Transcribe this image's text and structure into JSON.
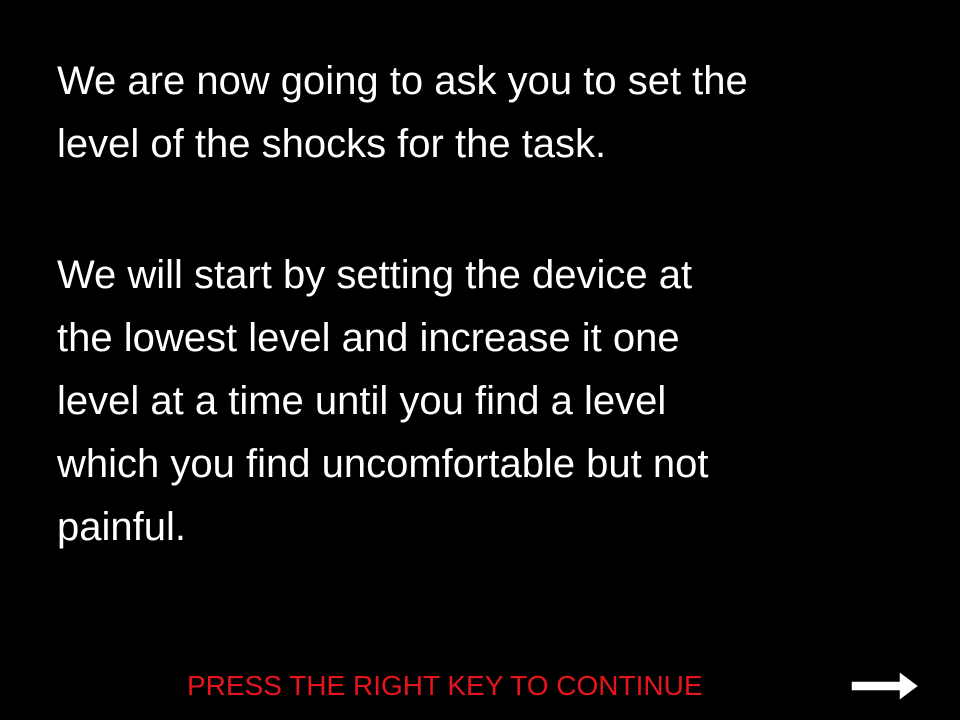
{
  "instructions": {
    "paragraph_1": [
      "We are now going to ask you to set the",
      "level of the shocks for the task."
    ],
    "paragraph_2": [
      "We will start by setting the device at",
      "the lowest level and increase it one",
      "level at a time until you find a level",
      "which you find uncomfortable but not",
      "painful."
    ]
  },
  "continue_prompt": {
    "label": "PRESS THE RIGHT KEY TO CONTINUE",
    "color": "#e8141c"
  },
  "next_icon": "right-arrow-icon",
  "colors": {
    "background": "#000000",
    "text": "#ffffff",
    "arrow": "#ffffff"
  }
}
